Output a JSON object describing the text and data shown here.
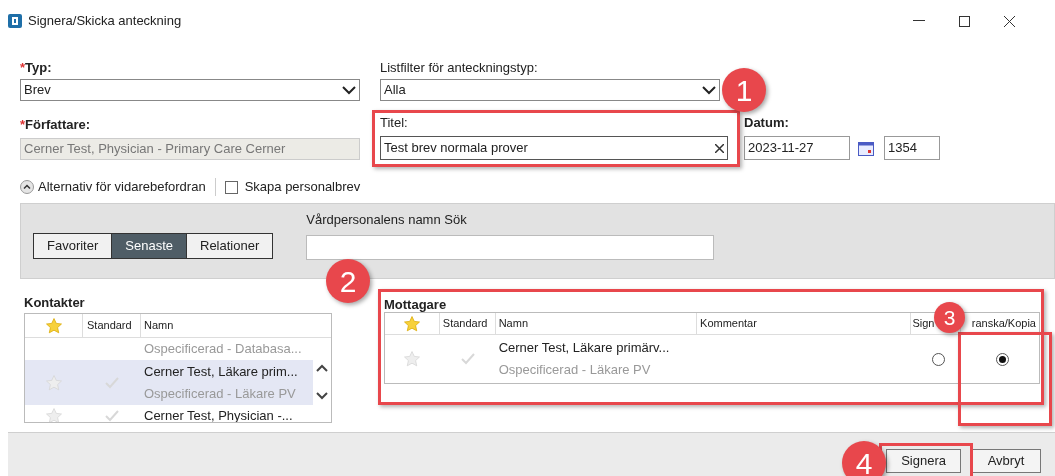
{
  "window": {
    "title": "Signera/Skicka anteckning"
  },
  "form": {
    "type": {
      "label": "Typ:",
      "required_mark": "*",
      "value": "Brev"
    },
    "list_filter": {
      "label": "Listfilter för anteckningstyp:",
      "value": "Alla"
    },
    "author": {
      "label": "Författare:",
      "required_mark": "*",
      "value": "Cerner Test, Physician - Primary Care Cerner",
      "disabled": true
    },
    "title": {
      "label": "Titel:",
      "value": "Test brev normala prover"
    },
    "date": {
      "label": "Datum:",
      "value": "2023-11-27",
      "time": "1354"
    }
  },
  "forwarding": {
    "label": "Alternativ för vidarebefordran",
    "expanded": true
  },
  "personal_letter": {
    "label": "Skapa personalbrev",
    "checked": false
  },
  "filter_tabs": [
    {
      "label": "Favoriter",
      "selected": false
    },
    {
      "label": "Senaste",
      "selected": true
    },
    {
      "label": "Relationer",
      "selected": false
    }
  ],
  "search": {
    "label": "Vårdpersonalens namn Sök"
  },
  "contacts": {
    "title": "Kontakter",
    "columns": [
      "Standard",
      "Namn"
    ],
    "rows": [
      {
        "detail": "Ospecificerad - Databasa...",
        "selected": false
      },
      {
        "name": "Cerner Test, Läkare prim...",
        "detail": "Ospecificerad - Läkare PV",
        "selected": true
      },
      {
        "name": "Cerner Test, Physician -...",
        "selected": false
      }
    ]
  },
  "recipients": {
    "title": "Mottagare",
    "columns": [
      "Standard",
      "Namn",
      "Kommentar",
      "Sign",
      "ranska/Kopia"
    ],
    "rows": [
      {
        "name": "Cerner Test, Läkare primärv...",
        "detail": "Ospecificerad - Läkare PV",
        "choices": [
          {
            "selected": false
          },
          {
            "selected": true
          }
        ]
      }
    ]
  },
  "buttons": [
    "Signera",
    "Avbryt"
  ],
  "callouts": [
    {
      "label": "1"
    },
    {
      "label": "2"
    },
    {
      "label": "3"
    },
    {
      "label": "4"
    }
  ]
}
